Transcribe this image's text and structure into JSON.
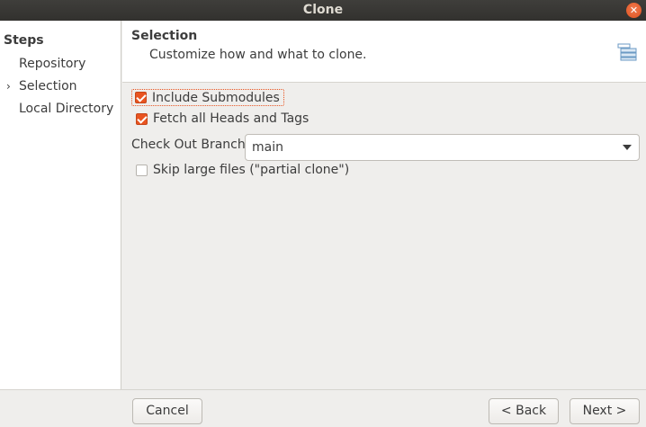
{
  "window": {
    "title": "Clone"
  },
  "steps": {
    "title": "Steps",
    "items": [
      {
        "label": "Repository",
        "current": false
      },
      {
        "label": "Selection",
        "current": true
      },
      {
        "label": "Local Directory",
        "current": false
      }
    ]
  },
  "header": {
    "title": "Selection",
    "description": "Customize how and what to clone.",
    "icon": "wizard-list-icon"
  },
  "options": {
    "include_submodules": {
      "label": "Include Submodules",
      "checked": true
    },
    "fetch_all": {
      "label": "Fetch all Heads and Tags",
      "checked": true
    },
    "branch_label": "Check Out Branch:",
    "branch_value": "main",
    "skip_large": {
      "label": "Skip large files (\"partial clone\")",
      "checked": false
    }
  },
  "buttons": {
    "cancel": "Cancel",
    "back": "< Back",
    "next": "Next >"
  },
  "colors": {
    "accent": "#e95420",
    "titlebar": "#3a3935"
  }
}
